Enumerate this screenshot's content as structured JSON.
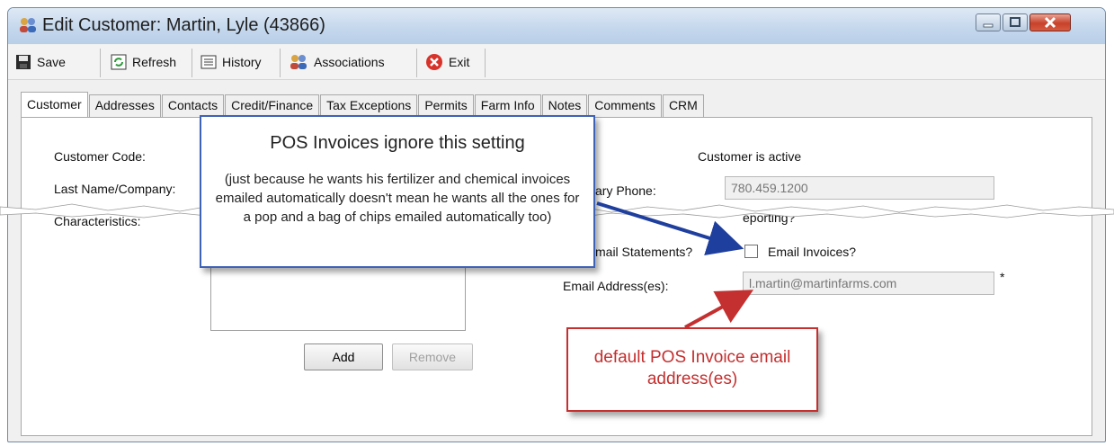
{
  "window": {
    "title": "Edit Customer: Martin, Lyle (43866)"
  },
  "toolbar": {
    "save": "Save",
    "refresh": "Refresh",
    "history": "History",
    "associations": "Associations",
    "exit": "Exit"
  },
  "tabs": [
    "Customer",
    "Addresses",
    "Contacts",
    "Credit/Finance",
    "Tax Exceptions",
    "Permits",
    "Farm Info",
    "Notes",
    "Comments",
    "CRM"
  ],
  "form": {
    "customer_code_label": "Customer Code:",
    "last_name_label": "Last Name/Company:",
    "characteristics_label": "Characteristics:",
    "customer_active": "Customer is active",
    "primary_phone_label": "ary Phone:",
    "primary_phone_value": "780.459.1200",
    "reporting_label": "eporting?",
    "email_statements_label": "mail Statements?",
    "email_invoices_label": "Email Invoices?",
    "email_address_label": "Email Address(es):",
    "email_address_value": "l.martin@martinfarms.com",
    "required_marker": "*",
    "add_button": "Add",
    "remove_button": "Remove"
  },
  "callout_blue": {
    "heading": "POS Invoices ignore this setting",
    "body": "(just because he wants his fertilizer and chemical invoices emailed automatically doesn't mean he wants all the ones for a pop and a bag of chips emailed automatically too)"
  },
  "callout_red": {
    "text": "default POS Invoice email address(es)"
  },
  "colors": {
    "callout_blue_border": "#3e63b6",
    "arrow_blue": "#1f3f9e",
    "callout_red_border": "#c42f2f",
    "arrow_red": "#c42f2f"
  }
}
